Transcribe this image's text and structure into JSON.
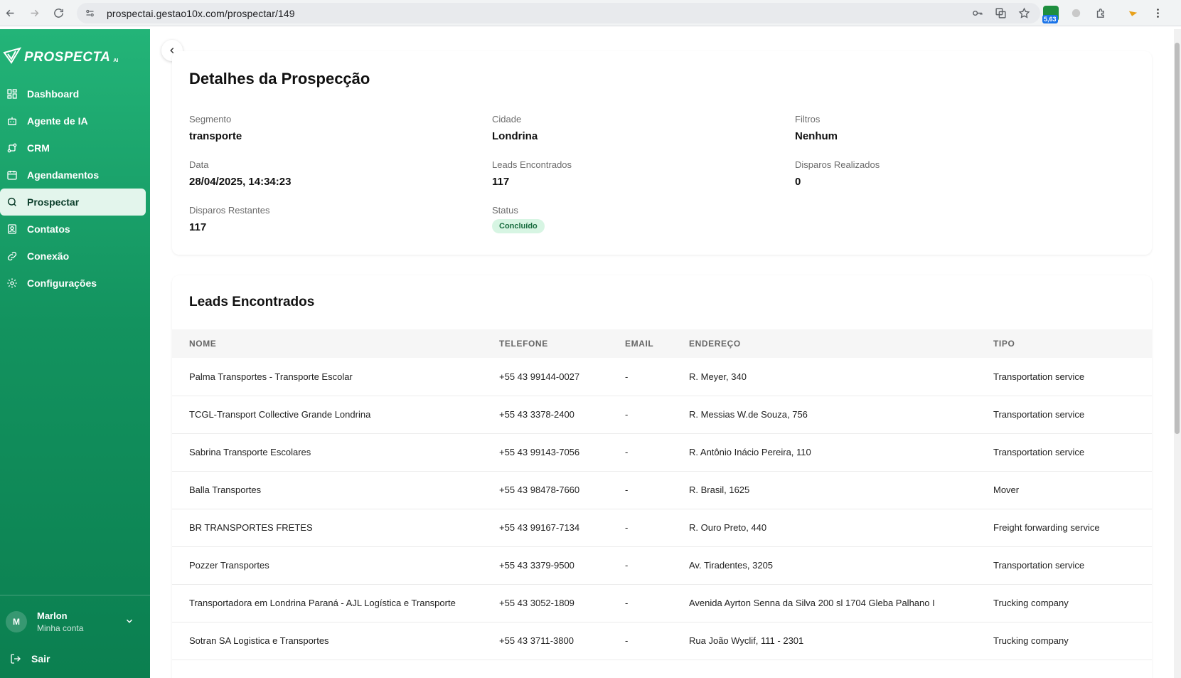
{
  "browser": {
    "url": "prospectai.gestao10x.com/prospectar/149",
    "extension_badge": "5,63"
  },
  "sidebar": {
    "logo_text": "PROSPECTA",
    "logo_suffix": "AI",
    "items": [
      {
        "label": "Dashboard",
        "icon": "dashboard-icon"
      },
      {
        "label": "Agente de IA",
        "icon": "bot-icon"
      },
      {
        "label": "CRM",
        "icon": "crm-icon"
      },
      {
        "label": "Agendamentos",
        "icon": "calendar-icon"
      },
      {
        "label": "Prospectar",
        "icon": "search-icon",
        "active": true
      },
      {
        "label": "Contatos",
        "icon": "contacts-icon"
      },
      {
        "label": "Conexão",
        "icon": "link-icon"
      },
      {
        "label": "Configurações",
        "icon": "gear-icon"
      }
    ],
    "user": {
      "initial": "M",
      "name": "Marlon",
      "subtitle": "Minha conta"
    },
    "logout_label": "Sair"
  },
  "details": {
    "title": "Detalhes da Prospecção",
    "segmento": {
      "label": "Segmento",
      "value": "transporte"
    },
    "cidade": {
      "label": "Cidade",
      "value": "Londrina"
    },
    "filtros": {
      "label": "Filtros",
      "value": "Nenhum"
    },
    "data": {
      "label": "Data",
      "value": "28/04/2025, 14:34:23"
    },
    "leads_encontrados": {
      "label": "Leads Encontrados",
      "value": "117"
    },
    "disparos_realizados": {
      "label": "Disparos Realizados",
      "value": "0"
    },
    "disparos_restantes": {
      "label": "Disparos Restantes",
      "value": "117"
    },
    "status": {
      "label": "Status",
      "value": "Concluído"
    }
  },
  "leads": {
    "title": "Leads Encontrados",
    "columns": [
      "NOME",
      "TELEFONE",
      "EMAIL",
      "ENDEREÇO",
      "TIPO"
    ],
    "rows": [
      [
        "Palma Transportes - Transporte Escolar",
        "+55 43 99144-0027",
        "-",
        "R. Meyer, 340",
        "Transportation service"
      ],
      [
        "TCGL-Transport Collective Grande Londrina",
        "+55 43 3378-2400",
        "-",
        "R. Messias W.de Souza, 756",
        "Transportation service"
      ],
      [
        "Sabrina Transporte Escolares",
        "+55 43 99143-7056",
        "-",
        "R. Antônio Inácio Pereira, 110",
        "Transportation service"
      ],
      [
        "Balla Transportes",
        "+55 43 98478-7660",
        "-",
        "R. Brasil, 1625",
        "Mover"
      ],
      [
        "BR TRANSPORTES FRETES",
        "+55 43 99167-7134",
        "-",
        "R. Ouro Preto, 440",
        "Freight forwarding service"
      ],
      [
        "Pozzer Transportes",
        "+55 43 3379-9500",
        "-",
        "Av. Tiradentes, 3205",
        "Transportation service"
      ],
      [
        "Transportadora em Londrina Paraná - AJL Logística e Transporte",
        "+55 43 3052-1809",
        "-",
        "Avenida Ayrton Senna da Silva 200 sl 1704 Gleba Palhano I",
        "Trucking company"
      ],
      [
        "Sotran SA Logistica e Transportes",
        "+55 43 3711-3800",
        "-",
        "Rua João Wyclif, 111 - 2301",
        "Trucking company"
      ]
    ]
  }
}
